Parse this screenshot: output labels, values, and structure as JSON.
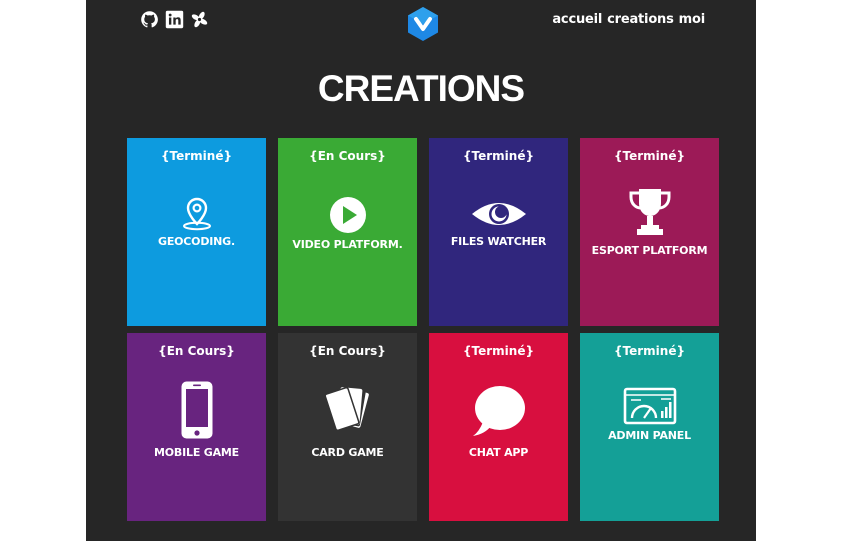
{
  "header": {
    "social_icons": [
      "github-icon",
      "linkedin-icon",
      "codeberg-icon"
    ],
    "logo_icon": "vuetify-logo-icon",
    "nav": [
      "accueil",
      "creations",
      "moi"
    ]
  },
  "page_title": "CREATIONS",
  "colors": {
    "background": "#262626",
    "geocoding": "#0d9bdf",
    "video": "#3aaa35",
    "files": "#30267d",
    "esport": "#9c1a57",
    "mobile": "#68247f",
    "card": "#333333",
    "chat": "#d80f3f",
    "admin": "#14a097"
  },
  "cards": [
    {
      "status": "{Terminé}",
      "name": "GEOCODING.",
      "icon": "map-pin-icon"
    },
    {
      "status": "{En Cours}",
      "name": "VIDEO PLATFORM.",
      "icon": "play-icon"
    },
    {
      "status": "{Terminé}",
      "name": "FILES WATCHER",
      "icon": "eye-icon"
    },
    {
      "status": "{Terminé}",
      "name": "ESPORT PLATFORM",
      "icon": "trophy-icon"
    },
    {
      "status": "{En Cours}",
      "name": "MOBILE GAME",
      "icon": "smartphone-icon"
    },
    {
      "status": "{En Cours}",
      "name": "CARD GAME",
      "icon": "cards-icon"
    },
    {
      "status": "{Terminé}",
      "name": "CHAT APP",
      "icon": "chat-bubble-icon"
    },
    {
      "status": "{Terminé}",
      "name": "ADMIN PANEL",
      "icon": "dashboard-icon"
    }
  ]
}
